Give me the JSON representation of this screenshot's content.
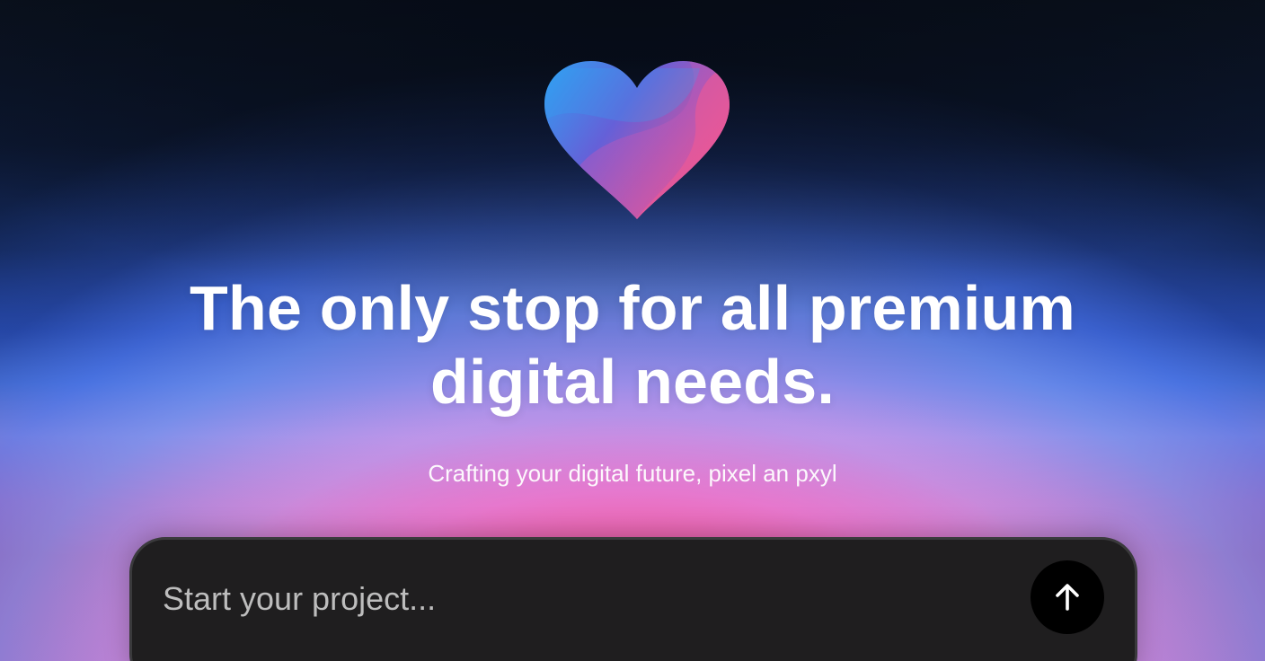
{
  "colors": {
    "heart_left": "#2f9bf0",
    "heart_mid": "#6b5fd6",
    "heart_right": "#f0508e",
    "prompt_bg": "#1f1e1f",
    "submit_bg": "#000000",
    "text": "#ffffff"
  },
  "hero": {
    "logo_icon": "heart-icon",
    "headline_line1": "The only stop for all premium",
    "headline_line2": "digital needs.",
    "subtitle": "Crafting your digital future, pixel an pxyl"
  },
  "prompt": {
    "placeholder": "Start your project...",
    "submit_icon": "arrow-up-icon"
  }
}
